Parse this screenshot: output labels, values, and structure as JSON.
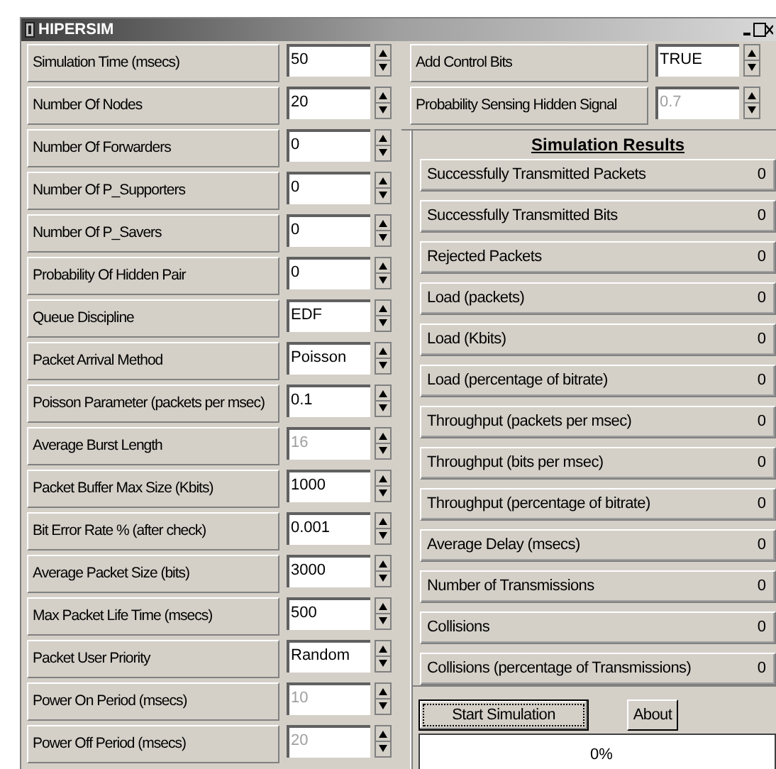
{
  "window": {
    "title": "HIPERSIM"
  },
  "parameters": [
    {
      "label": "Simulation Time (msecs)",
      "value": "50",
      "disabled": false
    },
    {
      "label": "Number Of Nodes",
      "value": "20",
      "disabled": false
    },
    {
      "label": "Number Of Forwarders",
      "value": "0",
      "disabled": false
    },
    {
      "label": "Number Of P_Supporters",
      "value": "0",
      "disabled": false
    },
    {
      "label": "Number Of P_Savers",
      "value": "0",
      "disabled": false
    },
    {
      "label": "Probability Of Hidden Pair",
      "value": "0",
      "disabled": false
    },
    {
      "label": "Queue Discipline",
      "value": "EDF",
      "disabled": false
    },
    {
      "label": "Packet Arrival Method",
      "value": "Poisson",
      "disabled": false
    },
    {
      "label": "Poisson Parameter (packets per msec)",
      "value": "0.1",
      "disabled": false
    },
    {
      "label": "Average Burst Length",
      "value": "16",
      "disabled": true
    },
    {
      "label": "Packet Buffer Max Size (Kbits)",
      "value": "1000",
      "disabled": false
    },
    {
      "label": "Bit Error Rate % (after check)",
      "value": "0.001",
      "disabled": false
    },
    {
      "label": "Average Packet Size (bits)",
      "value": "3000",
      "disabled": false
    },
    {
      "label": "Max Packet Life Time (msecs)",
      "value": "500",
      "disabled": false
    },
    {
      "label": "Packet User Priority",
      "value": "Random",
      "disabled": false
    },
    {
      "label": "Power On Period (msecs)",
      "value": "10",
      "disabled": true
    },
    {
      "label": "Power Off Period (msecs)",
      "value": "20",
      "disabled": true
    }
  ],
  "right_parameters": [
    {
      "label": "Add Control Bits",
      "value": "TRUE",
      "disabled": false
    },
    {
      "label": "Probability Sensing Hidden Signal",
      "value": "0.7",
      "disabled": true
    }
  ],
  "results": {
    "title": "Simulation Results",
    "rows": [
      {
        "label": "Successfully Transmitted Packets",
        "value": "0"
      },
      {
        "label": "Successfully Transmitted Bits",
        "value": "0"
      },
      {
        "label": "Rejected Packets",
        "value": "0"
      },
      {
        "label": "Load (packets)",
        "value": "0"
      },
      {
        "label": "Load (Kbits)",
        "value": "0"
      },
      {
        "label": "Load (percentage of bitrate)",
        "value": "0"
      },
      {
        "label": "Throughput (packets per msec)",
        "value": "0"
      },
      {
        "label": "Throughput (bits per msec)",
        "value": "0"
      },
      {
        "label": "Throughput (percentage of bitrate)",
        "value": "0"
      },
      {
        "label": "Average Delay (msecs)",
        "value": "0"
      },
      {
        "label": "Number of Transmissions",
        "value": "0"
      },
      {
        "label": "Collisions",
        "value": "0"
      },
      {
        "label": "Collisions (percentage of Transmissions)",
        "value": "0"
      }
    ]
  },
  "buttons": [
    "Start Simulation",
    "About"
  ],
  "progress": {
    "text": "0%"
  }
}
